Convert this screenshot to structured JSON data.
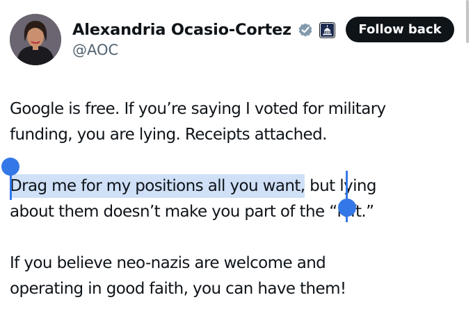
{
  "profile": {
    "display_name": "Alexandria Ocasio-Cortez",
    "handle": "@AOC",
    "verified_icon": "verified-badge-icon",
    "affiliation_icon": "government-capitol-icon"
  },
  "follow_button": {
    "label": "Follow back"
  },
  "tweet": {
    "paragraph_1": "Google is free. If you’re saying I voted for military funding, you are lying. Receipts attached.",
    "paragraph_1_line_1": "Google is free. If you’re saying I voted for military",
    "paragraph_1_line_2": "funding, you are lying. Receipts attached.",
    "paragraph_2_selected": "Drag me for my positions all you want,",
    "paragraph_2_line_1_rest": " but lying",
    "paragraph_2_line_2": "about them doesn’t make you part of the “left.”",
    "paragraph_3_line_1": "If you believe neo-nazis are welcome and",
    "paragraph_3_line_2": "operating in good faith, you can have them!"
  },
  "colors": {
    "text": "#0f1419",
    "secondary_text": "#536471",
    "button_bg": "#0f1419",
    "verified": "#829aab",
    "selection": "#cfe0f7",
    "selection_handle": "#3478e8"
  }
}
